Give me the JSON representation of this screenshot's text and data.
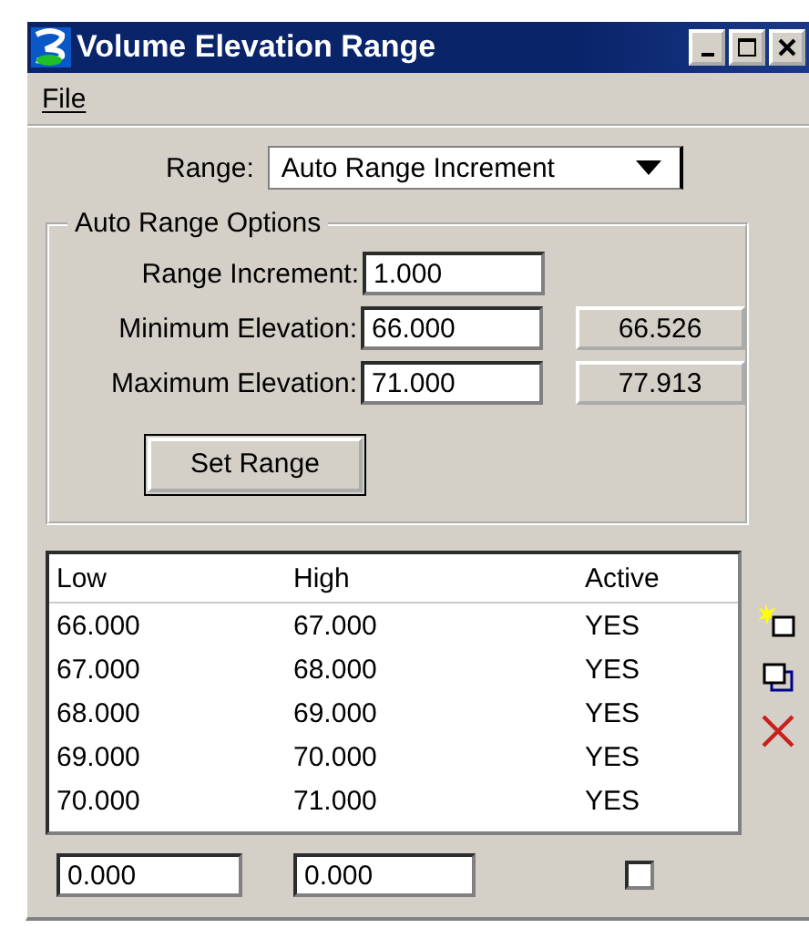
{
  "window": {
    "title": "Volume Elevation Range"
  },
  "menu": [
    {
      "label": "File"
    }
  ],
  "range": {
    "label": "Range:",
    "value": "Auto Range Increment"
  },
  "options": {
    "title": "Auto Range Options",
    "rows": [
      {
        "label": "Range Increment:",
        "value": "1.000"
      },
      {
        "label": "Minimum Elevation:",
        "value": "66.000",
        "button": "66.526"
      },
      {
        "label": "Maximum Elevation:",
        "value": "71.000",
        "button": "77.913"
      }
    ],
    "set_button": "Set Range"
  },
  "table": {
    "columns": [
      "Low",
      "High",
      "Active"
    ],
    "rows": [
      {
        "cells": [
          "66.000",
          "67.000",
          "YES"
        ]
      },
      {
        "cells": [
          "67.000",
          "68.000",
          "YES"
        ]
      },
      {
        "cells": [
          "68.000",
          "69.000",
          "YES"
        ]
      },
      {
        "cells": [
          "69.000",
          "70.000",
          "YES"
        ]
      },
      {
        "cells": [
          "70.000",
          "71.000",
          "YES"
        ]
      }
    ]
  },
  "editor": {
    "low": "0.000",
    "high": "0.000",
    "active_checked": false
  }
}
